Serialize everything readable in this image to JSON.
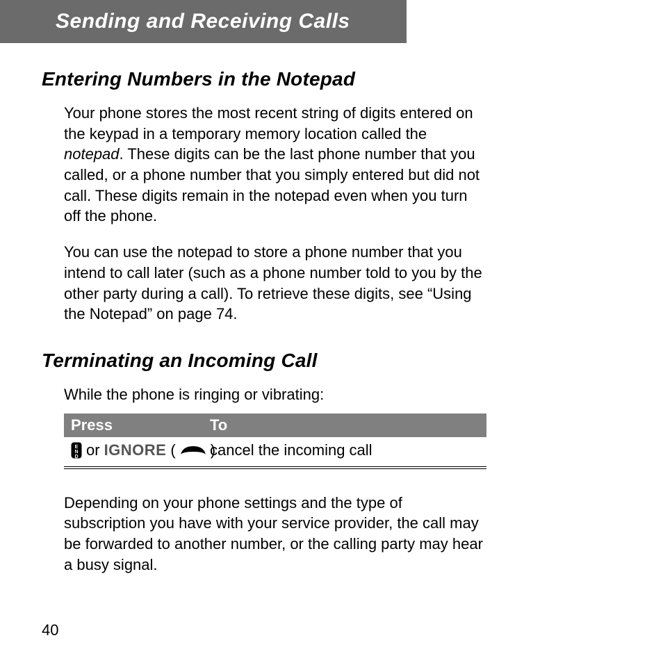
{
  "banner": {
    "title": "Sending and Receiving Calls"
  },
  "sections": {
    "notepad": {
      "heading": "Entering Numbers in the Notepad",
      "para1_a": "Your phone stores the most recent string of digits entered on the keypad in a temporary memory location called the ",
      "para1_kw": "notepad",
      "para1_b": ". These digits can be the last phone number that you called, or a phone number that you simply entered but did not call. These digits remain in the notepad even when you turn off the phone.",
      "para2": "You can use the notepad to store a phone number that you intend to call later (such as a phone number told to you by the other party during a call). To retrieve these digits, see “Using the Notepad” on page 74."
    },
    "terminate": {
      "heading": "Terminating an Incoming Call",
      "intro": "While the phone is ringing or vibrating:",
      "table": {
        "head": {
          "press": "Press",
          "to": "To"
        },
        "row": {
          "or": " or ",
          "ignore": "IGNORE",
          "lparen": " (",
          "rparen": ")",
          "action": "cancel the incoming call"
        }
      },
      "para_after": "Depending on your phone settings and the type of subscription you have with your service provider, the call may be forwarded to another number, or the calling party may hear a busy signal."
    }
  },
  "page_number": "40"
}
